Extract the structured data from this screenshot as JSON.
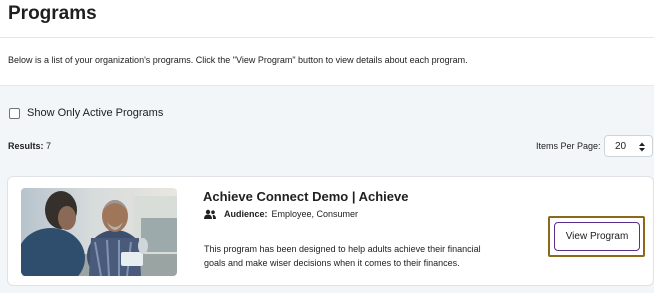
{
  "header": {
    "title": "Programs"
  },
  "intro": {
    "text": "Below is a list of your organization's programs. Click the \"View Program\" button to view details about each program."
  },
  "filter": {
    "label": "Show Only Active Programs",
    "checked": false
  },
  "results": {
    "label": "Results:",
    "count": "7"
  },
  "items_per_page": {
    "label": "Items Per Page:",
    "value": "20"
  },
  "program_card": {
    "title": "Achieve Connect Demo | Achieve",
    "audience_label": "Audience:",
    "audience_value": "Employee, Consumer",
    "description": "This program has been designed to help adults achieve their financial goals and make wiser decisions when it comes to their finances.",
    "button_label": "View Program",
    "image_icon": "photo-two-people-meeting"
  },
  "colors": {
    "accent": "#5a2f8c",
    "focus": "#8a6a18",
    "background": "#f2f6f8"
  }
}
